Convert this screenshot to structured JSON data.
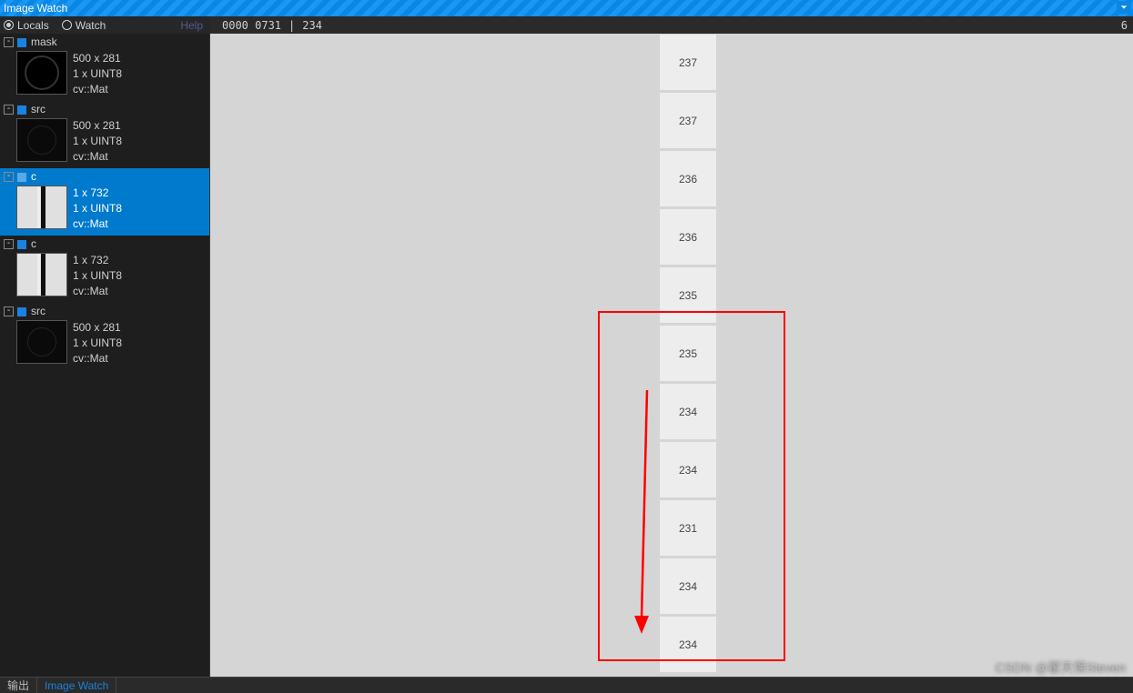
{
  "title": "Image Watch",
  "modes": {
    "locals": "Locals",
    "watch": "Watch"
  },
  "help_label": "Help",
  "status": {
    "coords": "0000  0731",
    "sep": "|",
    "value": "234",
    "right": "6"
  },
  "variables": [
    {
      "name": "mask",
      "dims": "500 x 281",
      "type": "1 x UINT8",
      "cls": "cv::Mat",
      "thumb": "mask",
      "chip": "dark",
      "selected": false
    },
    {
      "name": "src",
      "dims": "500 x 281",
      "type": "1 x UINT8",
      "cls": "cv::Mat",
      "thumb": "src",
      "chip": "dark",
      "selected": false
    },
    {
      "name": "c",
      "dims": "1 x 732",
      "type": "1 x UINT8",
      "cls": "cv::Mat",
      "thumb": "vec",
      "chip": "light",
      "selected": true
    },
    {
      "name": "c",
      "dims": "1 x 732",
      "type": "1 x UINT8",
      "cls": "cv::Mat",
      "thumb": "vec",
      "chip": "dark",
      "selected": false
    },
    {
      "name": "src",
      "dims": "500 x 281",
      "type": "1 x UINT8",
      "cls": "cv::Mat",
      "thumb": "src",
      "chip": "dark",
      "selected": false
    }
  ],
  "pixel_values": [
    "237",
    "237",
    "236",
    "236",
    "235",
    "235",
    "234",
    "234",
    "231",
    "234",
    "234"
  ],
  "footer": {
    "output": "输出",
    "imagewatch": "Image Watch"
  },
  "watermark": "CSDN @翟天保Steven",
  "colors": {
    "accent": "#007acc",
    "titlebar": "#0a86e4",
    "red": "#ff0000"
  }
}
